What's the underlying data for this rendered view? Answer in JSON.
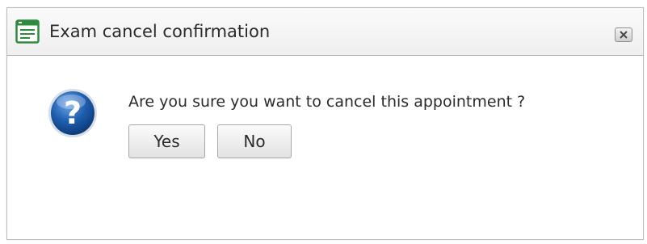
{
  "dialog": {
    "title": "Exam cancel confirmation",
    "icon": "form-window-icon",
    "close_icon": "close-icon",
    "message": "Are you sure you want to cancel this appointment ?",
    "message_icon": "question-icon",
    "buttons": {
      "yes_label": "Yes",
      "no_label": "No"
    }
  },
  "colors": {
    "title_icon_green": "#2e8b3e",
    "question_blue": "#1f5fb0",
    "border": "#a9a9a9"
  }
}
